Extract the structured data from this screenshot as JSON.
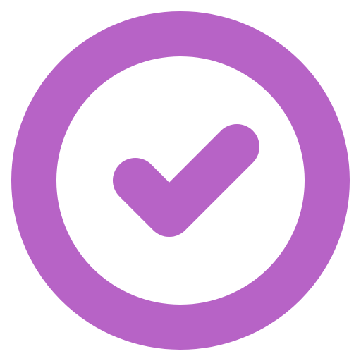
{
  "icon": {
    "name": "check-circle-icon",
    "color": "#B763C6",
    "background": "#FFFFFF"
  }
}
